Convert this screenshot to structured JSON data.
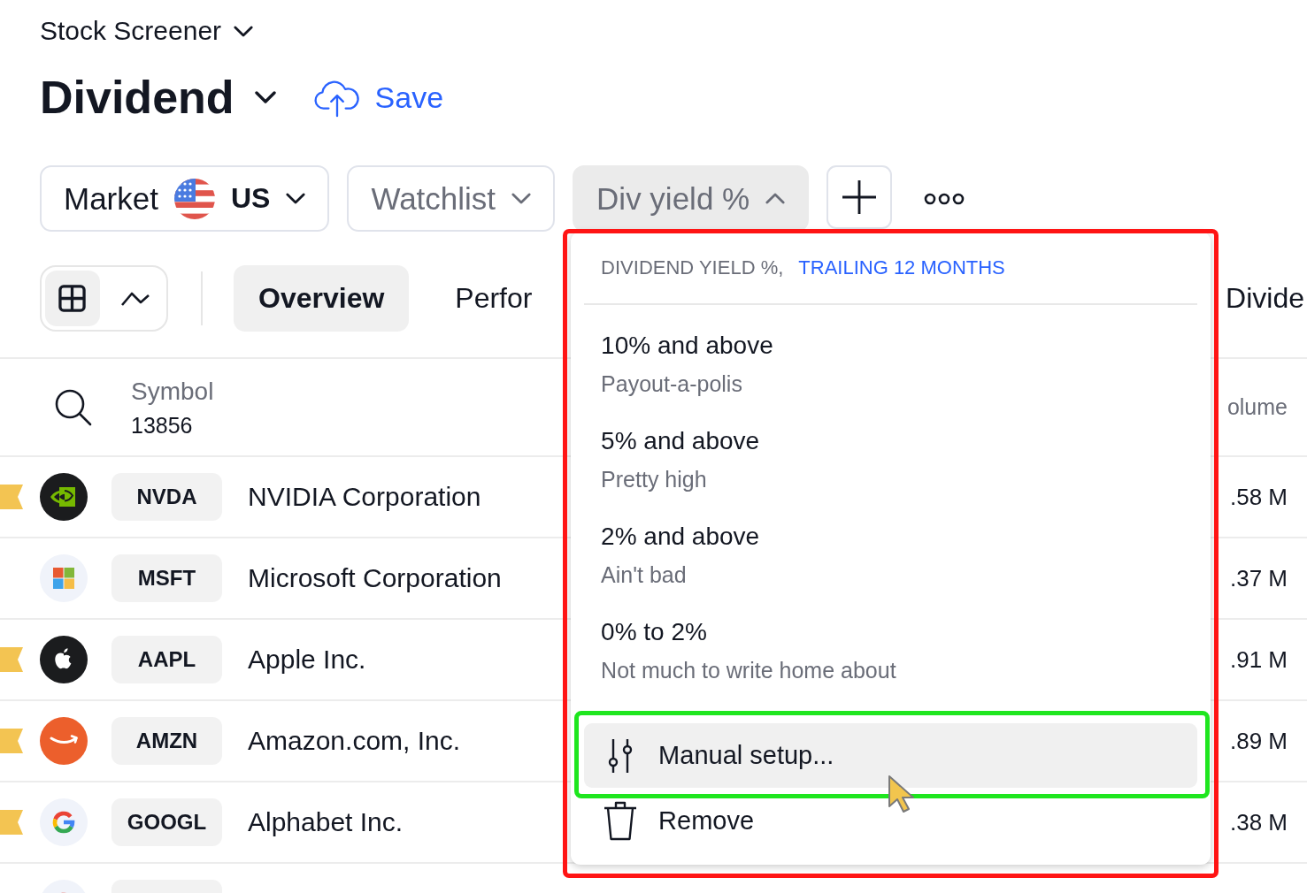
{
  "header": {
    "screener_menu": "Stock Screener",
    "screen_name": "Dividend",
    "save_label": "Save"
  },
  "filters": [
    {
      "kind": "market",
      "label": "Market",
      "value": "US",
      "expanded": false
    },
    {
      "kind": "select",
      "label": "Watchlist",
      "expanded": false
    },
    {
      "kind": "select",
      "label": "Div yield %",
      "expanded": true,
      "menu": {
        "title": "DIVIDEND YIELD %,",
        "period": "TRAILING 12 MONTHS",
        "annotated": true,
        "presets": [
          {
            "title": "10% and above",
            "subtitle": "Payout-a-polis"
          },
          {
            "title": "5% and above",
            "subtitle": "Pretty high"
          },
          {
            "title": "2% and above",
            "subtitle": "Ain't bad"
          },
          {
            "title": "0% to 2%",
            "subtitle": "Not much to write home about"
          }
        ],
        "actions": [
          {
            "kind": "setup",
            "label": "Manual setup...",
            "hovered": true,
            "annotated": true
          },
          {
            "kind": "delete",
            "label": "Remove",
            "hovered": false,
            "annotated": false
          }
        ]
      }
    }
  ],
  "view_modes": [
    {
      "kind": "table",
      "selected": true
    },
    {
      "kind": "chart",
      "selected": false
    }
  ],
  "tabs": [
    {
      "label": "Overview",
      "selected": true
    },
    {
      "label": "Perfor",
      "selected": false
    },
    {
      "label": "Divide",
      "selected": false
    }
  ],
  "table": {
    "symbol_header": "Symbol",
    "symbol_count": "13856",
    "volume_header": "olume",
    "rows": [
      {
        "flagged": true,
        "ticker": "NVDA",
        "name": "NVIDIA Corporation",
        "volume": ".58 M"
      },
      {
        "flagged": false,
        "ticker": "MSFT",
        "name": "Microsoft Corporation",
        "volume": ".37 M"
      },
      {
        "flagged": true,
        "ticker": "AAPL",
        "name": "Apple Inc.",
        "volume": ".91 M"
      },
      {
        "flagged": true,
        "ticker": "AMZN",
        "name": "Amazon.com, Inc.",
        "volume": ".89 M"
      },
      {
        "flagged": true,
        "ticker": "GOOGL",
        "name": "Alphabet Inc.",
        "volume": ".38 M"
      }
    ],
    "more_rows_below": true
  }
}
